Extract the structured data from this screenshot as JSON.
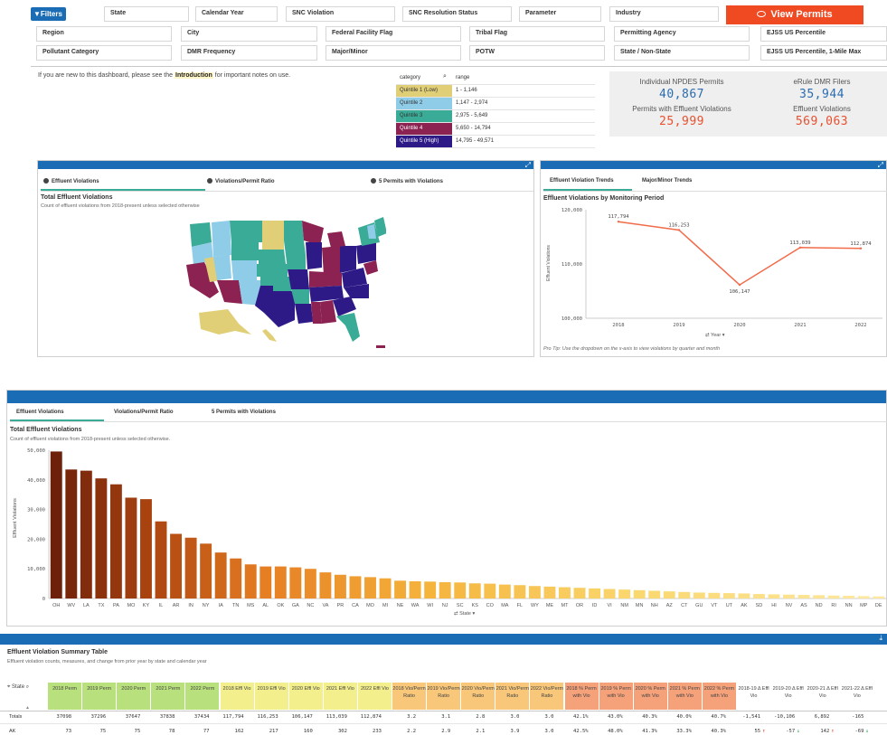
{
  "filters": {
    "button_label": "Filters",
    "view_permits_label": "View Permits",
    "row1": [
      "State",
      "Calendar Year",
      "SNC Violation",
      "SNC Resolution Status",
      "Parameter",
      "Industry"
    ],
    "row2": [
      "Region",
      "City",
      "Federal Facility Flag",
      "Tribal Flag",
      "Permitting Agency",
      "EJSS US Percentile"
    ],
    "row3": [
      "Pollutant Category",
      "DMR Frequency",
      "Major/Minor",
      "POTW",
      "State / Non-State",
      "EJSS US Percentile, 1-Mile Max"
    ]
  },
  "intro": {
    "before": "If you are new to this dashboard, please see the",
    "link": "Introduction",
    "after": "for important notes on use."
  },
  "legend": {
    "col_category": "category",
    "col_range": "range",
    "rows": [
      {
        "category": "Quintile 1 (Low)",
        "range": "1 - 1,146",
        "color": "#e0cf77"
      },
      {
        "category": "Quintile 2",
        "range": "1,147 - 2,974",
        "color": "#8fcce8"
      },
      {
        "category": "Quintile 3",
        "range": "2,975 - 5,649",
        "color": "#3aab96"
      },
      {
        "category": "Quintile 4",
        "range": "5,650 - 14,794",
        "color": "#8b2252"
      },
      {
        "category": "Quintile 5 (High)",
        "range": "14,795 - 49,571",
        "color": "#2e1a87"
      }
    ]
  },
  "kpi": {
    "npdes_label": "Individual NPDES Permits",
    "npdes_value": "40,867",
    "erule_label": "eRule DMR Filers",
    "erule_value": "35,944",
    "perm_viol_label": "Permits with Effluent Violations",
    "perm_viol_value": "25,999",
    "eff_viol_label": "Effluent Violations",
    "eff_viol_value": "569,063",
    "blue": "#2b6cb0",
    "red": "#e8502f"
  },
  "map_panel": {
    "tabs": [
      "Effluent Violations",
      "Violations/Permit Ratio",
      "5 Permits with Violations"
    ],
    "title": "Total Effluent Violations",
    "subtitle": "Count of effluent violations from 2018-present unless selected otherwise"
  },
  "trend_panel": {
    "tabs": [
      "Effluent Violation Trends",
      "Major/Minor Trends"
    ],
    "title": "Effluent Violations by Monitoring Period",
    "y_axis_label": "Effluent Violations",
    "x_dim_label": "Year",
    "tip": "Pro Tip: Use the dropdown on the x-axis to view violations by quarter and month"
  },
  "bar_panel": {
    "tabs": [
      "Effluent Violations",
      "Violations/Permit Ratio",
      "5 Permits with Violations"
    ],
    "title": "Total Effluent Violations",
    "subtitle": "Count of effluent violations from 2018-present unless selected otherwise.",
    "y_axis_label": "Effluent Violations",
    "x_dim_label": "State"
  },
  "summary": {
    "title": "Effluent Violation Summary Table",
    "subtitle": "Effluent violation counts, measures, and change from prior year by state and calendar year",
    "state_header": "State",
    "headers": [
      {
        "label": "2018 Perm",
        "bg": "#b8e07c"
      },
      {
        "label": "2019 Perm",
        "bg": "#b8e07c"
      },
      {
        "label": "2020 Perm",
        "bg": "#b8e07c"
      },
      {
        "label": "2021 Perm",
        "bg": "#b8e07c"
      },
      {
        "label": "2022 Perm",
        "bg": "#b8e07c"
      },
      {
        "label": "2018 Effl Vio",
        "bg": "#f2ef8c"
      },
      {
        "label": "2019 Effl Vio",
        "bg": "#f2ef8c"
      },
      {
        "label": "2020 Effl Vio",
        "bg": "#f2ef8c"
      },
      {
        "label": "2021 Effl Vio",
        "bg": "#f2ef8c"
      },
      {
        "label": "2022 Effl Vio",
        "bg": "#f2ef8c"
      },
      {
        "label": "2018 Vio/Perm Ratio",
        "bg": "#f8c77a"
      },
      {
        "label": "2019 Vio/Perm Ratio",
        "bg": "#f8c77a"
      },
      {
        "label": "2020 Vio/Perm Ratio",
        "bg": "#f8c77a"
      },
      {
        "label": "2021 Vio/Perm Ratio",
        "bg": "#f8c77a"
      },
      {
        "label": "2022 Vio/Perm Ratio",
        "bg": "#f8c77a"
      },
      {
        "label": "2018 % Perm with Vio",
        "bg": "#f5a17a"
      },
      {
        "label": "2019 % Perm with Vio",
        "bg": "#f5a17a"
      },
      {
        "label": "2020 % Perm with Vio",
        "bg": "#f5a17a"
      },
      {
        "label": "2021 % Perm with Vio",
        "bg": "#f5a17a"
      },
      {
        "label": "2022 % Perm with Vio",
        "bg": "#f5a17a"
      },
      {
        "label": "2018-19 Δ Effl Vio",
        "bg": "#ffffff"
      },
      {
        "label": "2019-20 Δ Effl Vio",
        "bg": "#ffffff"
      },
      {
        "label": "2020-21 Δ Effl Vio",
        "bg": "#ffffff"
      },
      {
        "label": "2021-22 Δ Effl Vio",
        "bg": "#ffffff"
      }
    ],
    "rows": [
      {
        "state": "Totals",
        "cells": [
          "37098",
          "37296",
          "37647",
          "37838",
          "37434",
          "117,794",
          "116,253",
          "106,147",
          "113,039",
          "112,874",
          "3.2",
          "3.1",
          "2.8",
          "3.0",
          "3.0",
          "42.1%",
          "43.0%",
          "40.3%",
          "40.0%",
          "40.7%",
          "-1,541",
          "-10,106",
          "6,892",
          "-165"
        ],
        "arrows": [
          "",
          "",
          "",
          ""
        ]
      },
      {
        "state": "AK",
        "cells": [
          "73",
          "75",
          "75",
          "78",
          "77",
          "162",
          "217",
          "160",
          "302",
          "233",
          "2.2",
          "2.9",
          "2.1",
          "3.9",
          "3.0",
          "42.5%",
          "48.0%",
          "41.3%",
          "33.3%",
          "40.3%",
          "55",
          "-57",
          "142",
          "-69"
        ],
        "arrows": [
          "up",
          "down",
          "up",
          "down"
        ]
      }
    ]
  },
  "chart_data": [
    {
      "type": "map",
      "title": "Total Effluent Violations",
      "note": "US choropleth by quintile of effluent violations"
    },
    {
      "type": "line",
      "title": "Effluent Violations by Monitoring Period",
      "x": [
        "2018",
        "2019",
        "2020",
        "2021",
        "2022"
      ],
      "values": [
        117794,
        116253,
        106147,
        113039,
        112874
      ],
      "labels": [
        "117,794",
        "116,253",
        "106,147",
        "113,039",
        "112,874"
      ],
      "ylim": [
        100000,
        120000
      ],
      "yticks": [
        "100,000",
        "110,000",
        "120,000"
      ],
      "ylabel": "Effluent Violations",
      "xlabel": "Year",
      "color": "#f26b4a"
    },
    {
      "type": "bar",
      "title": "Total Effluent Violations",
      "ylabel": "Effluent Violations",
      "xlabel": "State",
      "ylim": [
        0,
        50000
      ],
      "yticks": [
        "0",
        "10,000",
        "20,000",
        "30,000",
        "40,000",
        "50,000"
      ],
      "categories": [
        "OH",
        "WV",
        "LA",
        "TX",
        "PA",
        "MO",
        "KY",
        "IL",
        "AR",
        "IN",
        "NY",
        "IA",
        "TN",
        "MS",
        "AL",
        "OK",
        "GA",
        "NC",
        "VA",
        "PR",
        "CA",
        "MO",
        "MI",
        "NE",
        "WA",
        "WI",
        "NJ",
        "SC",
        "KS",
        "CO",
        "MA",
        "FL",
        "WY",
        "ME",
        "MT",
        "OR",
        "ID",
        "VI",
        "NM",
        "MN",
        "NH",
        "AZ",
        "CT",
        "GU",
        "VT",
        "UT",
        "AK",
        "SD",
        "HI",
        "NV",
        "AS",
        "ND",
        "RI",
        "NN",
        "MP",
        "DE"
      ],
      "values": [
        49571,
        43500,
        43100,
        40500,
        38500,
        34000,
        33500,
        26000,
        21800,
        20500,
        18500,
        15500,
        13500,
        11500,
        10800,
        10800,
        10500,
        10000,
        8800,
        8000,
        7500,
        7200,
        6800,
        6000,
        5800,
        5700,
        5500,
        5400,
        5100,
        5000,
        4700,
        4500,
        4200,
        4000,
        3800,
        3600,
        3400,
        3200,
        3000,
        2800,
        2600,
        2400,
        2200,
        2000,
        1900,
        1800,
        1700,
        1500,
        1400,
        1300,
        1200,
        1100,
        1000,
        900,
        800,
        700
      ]
    }
  ]
}
